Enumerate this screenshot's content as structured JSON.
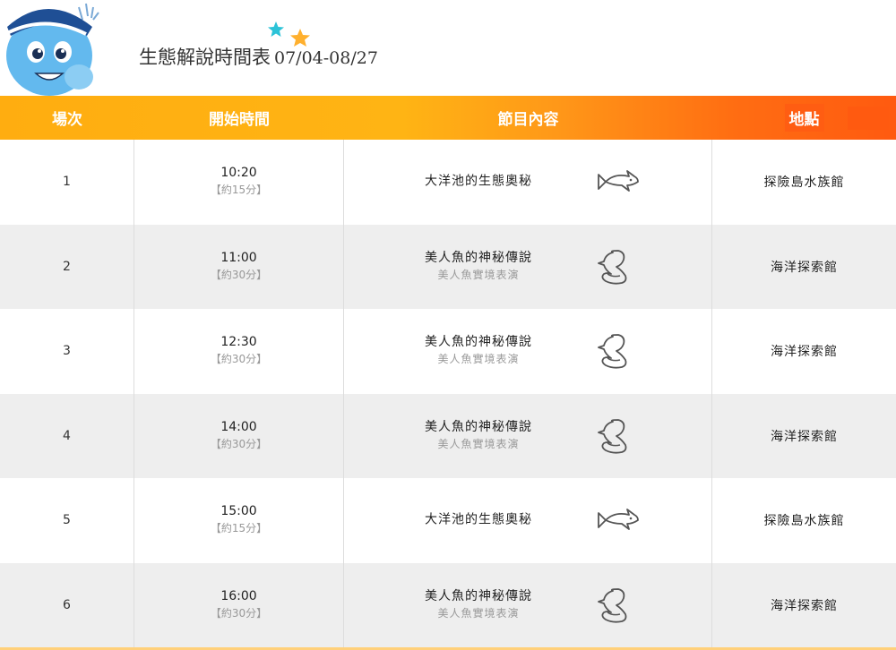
{
  "title": {
    "main": "生態解說時間表",
    "date": "07/04-08/27"
  },
  "table": {
    "headers": {
      "session": "場次",
      "start_time": "開始時間",
      "program": "節目內容",
      "location": "地點"
    },
    "rows": [
      {
        "session": "1",
        "time": "10:20",
        "duration": "【約15分】",
        "program": "大洋池的生態奧秘",
        "subtitle": "",
        "icon": "shark-icon",
        "location": "探險島水族館"
      },
      {
        "session": "2",
        "time": "11:00",
        "duration": "【約30分】",
        "program": "美人魚的神秘傳說",
        "subtitle": "美人魚實境表演",
        "icon": "mermaid-icon",
        "location": "海洋探索館"
      },
      {
        "session": "3",
        "time": "12:30",
        "duration": "【約30分】",
        "program": "美人魚的神秘傳說",
        "subtitle": "美人魚實境表演",
        "icon": "mermaid-icon",
        "location": "海洋探索館"
      },
      {
        "session": "4",
        "time": "14:00",
        "duration": "【約30分】",
        "program": "美人魚的神秘傳說",
        "subtitle": "美人魚實境表演",
        "icon": "mermaid-icon",
        "location": "海洋探索館"
      },
      {
        "session": "5",
        "time": "15:00",
        "duration": "【約15分】",
        "program": "大洋池的生態奧秘",
        "subtitle": "",
        "icon": "shark-icon",
        "location": "探險島水族館"
      },
      {
        "session": "6",
        "time": "16:00",
        "duration": "【約30分】",
        "program": "美人魚的神秘傳說",
        "subtitle": "美人魚實境表演",
        "icon": "mermaid-icon",
        "location": "海洋探索館"
      }
    ]
  },
  "colors": {
    "header_start": "#ffad10",
    "header_end": "#ff5a10",
    "alt_row": "#eeeeee",
    "title_highlight": "#ffe2b3"
  }
}
